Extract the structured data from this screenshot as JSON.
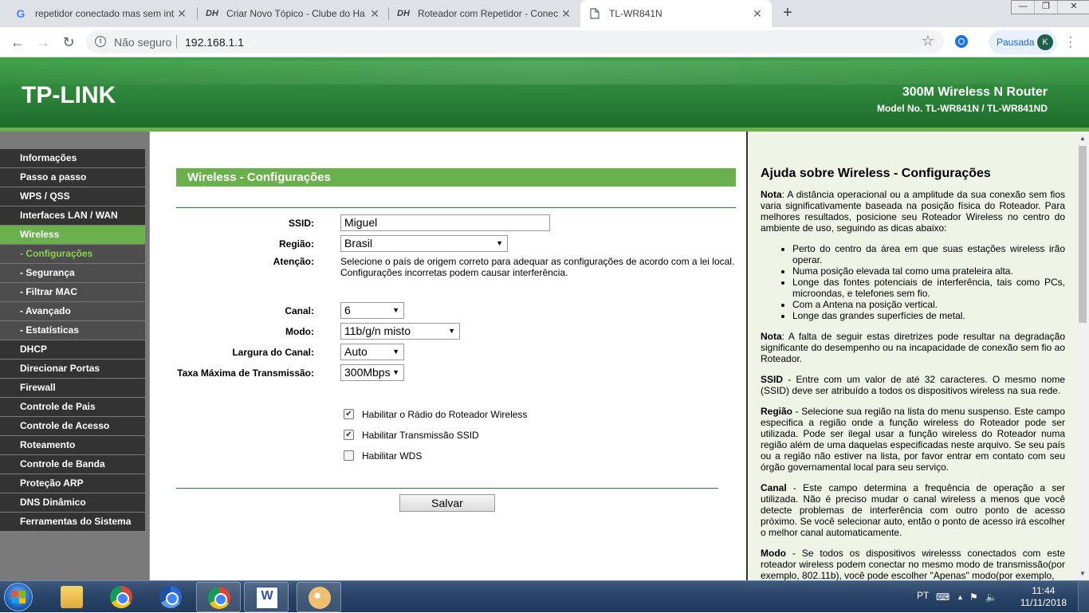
{
  "browser": {
    "tabs": [
      {
        "favicon": "G",
        "title": "repetidor conectado mas sem int",
        "active": false
      },
      {
        "favicon": "DH",
        "title": "Criar Novo Tópico - Clube do Ha",
        "active": false
      },
      {
        "favicon": "DH",
        "title": "Roteador com Repetidor - Conec",
        "active": false
      },
      {
        "favicon": "page-icon",
        "title": "TL-WR841N",
        "active": true
      }
    ],
    "new_tab": "+",
    "security_label": "Não seguro",
    "url": "192.168.1.1",
    "profile_label": "Pausada",
    "profile_initial": "K"
  },
  "router": {
    "logo": "TP-LINK",
    "product": "300M Wireless N Router",
    "model": "Model No. TL-WR841N / TL-WR841ND",
    "menu": [
      {
        "label": "Informações",
        "type": "main"
      },
      {
        "label": "Passo a passo",
        "type": "main"
      },
      {
        "label": "WPS / QSS",
        "type": "main"
      },
      {
        "label": "Interfaces LAN / WAN",
        "type": "main"
      },
      {
        "label": "Wireless",
        "type": "active"
      },
      {
        "label": "- Configurações",
        "type": "current"
      },
      {
        "label": "- Segurança",
        "type": "sub"
      },
      {
        "label": "- Filtrar MAC",
        "type": "sub"
      },
      {
        "label": "- Avançado",
        "type": "sub"
      },
      {
        "label": "- Estatísticas",
        "type": "sub"
      },
      {
        "label": "DHCP",
        "type": "main"
      },
      {
        "label": "Direcionar Portas",
        "type": "main"
      },
      {
        "label": "Firewall",
        "type": "main"
      },
      {
        "label": "Controle de Pais",
        "type": "main"
      },
      {
        "label": "Controle de Acesso",
        "type": "main"
      },
      {
        "label": "Roteamento",
        "type": "main"
      },
      {
        "label": "Controle de Banda",
        "type": "main"
      },
      {
        "label": "Proteção ARP",
        "type": "main"
      },
      {
        "label": "DNS Dinâmico",
        "type": "main"
      },
      {
        "label": "Ferramentas do Sistema",
        "type": "main"
      }
    ],
    "form": {
      "title": "Wireless - Configurações",
      "ssid_label": "SSID:",
      "ssid_value": "Miguel",
      "regiao_label": "Região:",
      "regiao_value": "Brasil",
      "atencao_label": "Atenção:",
      "atencao_text_1": "Selecione o país de origem correto para adequar as configurações de acordo com a lei local.",
      "atencao_text_2": "Configurações incorretas podem causar interferência.",
      "canal_label": "Canal:",
      "canal_value": "6",
      "modo_label": "Modo:",
      "modo_value": "11b/g/n misto",
      "largura_label": "Largura do Canal:",
      "largura_value": "Auto",
      "taxa_label": "Taxa Máxima de Transmissão:",
      "taxa_value": "300Mbps",
      "chk_radio_label": "Habilitar o Rádio do Roteador Wireless",
      "chk_radio_checked": true,
      "chk_ssid_label": "Habilitar Transmissão SSID",
      "chk_ssid_checked": true,
      "chk_wds_label": "Habilitar WDS",
      "chk_wds_checked": false,
      "save_label": "Salvar"
    },
    "help": {
      "title": "Ajuda sobre Wireless - Configurações",
      "nota1_b": "Nota",
      "nota1": ": A distância operacional ou a amplitude da sua conexão sem fios varia significativamente baseada na posição física do Roteador. Para melhores resultados, posicione seu Roteador Wireless no centro do ambiente de uso, seguindo as dicas abaixo:",
      "tips": [
        "Perto do centro da área em que suas estações wireless irão operar.",
        "Numa posição elevada tal como uma prateleira alta.",
        "Longe das fontes potenciais de interferência, tais como PCs, microondas, e telefones sem fio.",
        "Com a Antena na posição vertical.",
        "Longe das grandes superfícies de metal."
      ],
      "nota2_b": "Nota",
      "nota2": ": A falta de seguir estas diretrizes pode resultar na degradação significante do desempenho ou na incapacidade de conexão sem fio ao Roteador.",
      "ssid_b": "SSID",
      "ssid": " - Entre com um valor de até 32 caracteres. O mesmo nome (SSID) deve ser atribuído a todos os dispositivos wireless na sua rede.",
      "regiao_b": "Região",
      "regiao": " - Selecione sua região na lista do menu suspenso. Este campo especifica a região onde a função wireless do Roteador pode ser utilizada. Pode ser ilegal usar a função wireless do Roteador numa região além de uma daquelas especificadas neste arquivo. Se seu país ou a região não estiver na lista, por favor entrar em contato com seu órgão governamental local para seu serviço.",
      "canal_b": "Canal",
      "canal": " - Este campo determina a frequência de operação a ser utilizada. Não é preciso mudar o canal wireless a menos que você detecte problemas de interferência com outro ponto de acesso próximo. Se você selecionar auto, então o ponto de acesso irá escolher o melhor canal automaticamente.",
      "modo_b": "Modo",
      "modo": " - Se todos os dispositivos wirelesss conectados com este roteador wireless podem conectar no mesmo modo de transmissão(por exemplo, 802.11b), você pode escolher \"Apenas\" modo(por exemplo,"
    }
  },
  "taskbar": {
    "lang": "PT",
    "time": "11:44",
    "date": "11/11/2018"
  },
  "colors": {
    "tp_green": "#6ab04c",
    "menu_dark": "#333333",
    "help_bg": "#eef4e6"
  }
}
